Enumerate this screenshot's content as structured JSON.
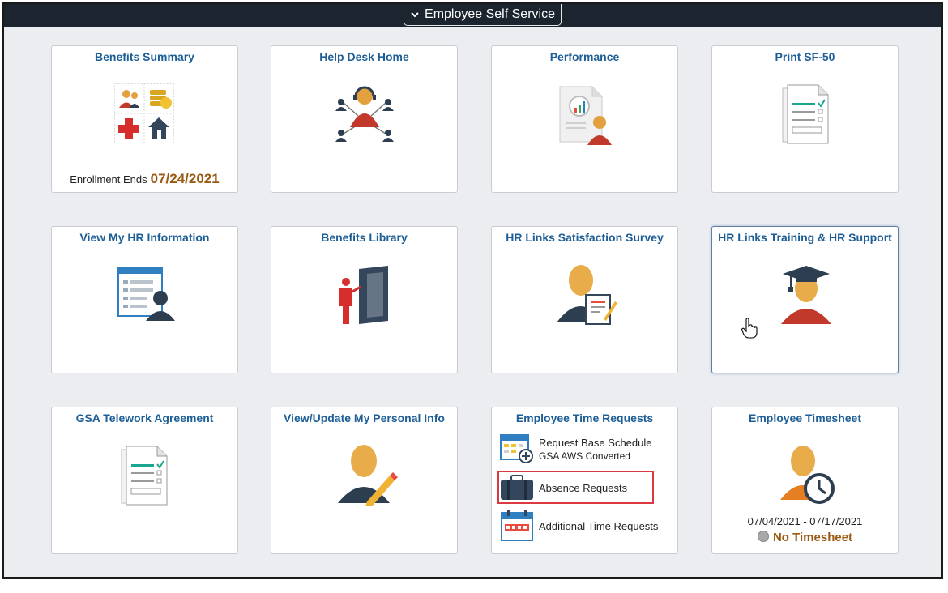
{
  "header": {
    "title": "Employee Self Service"
  },
  "tiles": {
    "benefits_summary": {
      "title": "Benefits Summary",
      "enroll_label": "Enrollment Ends",
      "enroll_date": "07/24/2021"
    },
    "help_desk_home": {
      "title": "Help Desk Home"
    },
    "performance": {
      "title": "Performance"
    },
    "print_sf50": {
      "title": "Print SF-50"
    },
    "view_hr_info": {
      "title": "View My HR Information"
    },
    "benefits_library": {
      "title": "Benefits Library"
    },
    "hr_survey": {
      "title": "HR Links Satisfaction Survey"
    },
    "hr_training": {
      "title": "HR Links Training & HR Support"
    },
    "gsa_telework": {
      "title": "GSA Telework Agreement"
    },
    "personal_info": {
      "title": "View/Update My Personal Info"
    },
    "time_requests": {
      "title": "Employee Time Requests",
      "items": [
        {
          "label": "Request Base Schedule",
          "sublabel": "GSA AWS Converted"
        },
        {
          "label": "Absence Requests"
        },
        {
          "label": "Additional Time Requests"
        }
      ]
    },
    "timesheet": {
      "title": "Employee Timesheet",
      "dates": "07/04/2021 - 07/17/2021",
      "status": "No Timesheet"
    }
  },
  "colors": {
    "header_bg": "#1c2430",
    "tile_title": "#1d5e96",
    "accent_orange": "#9a5a14",
    "highlight": "#d9393f"
  }
}
